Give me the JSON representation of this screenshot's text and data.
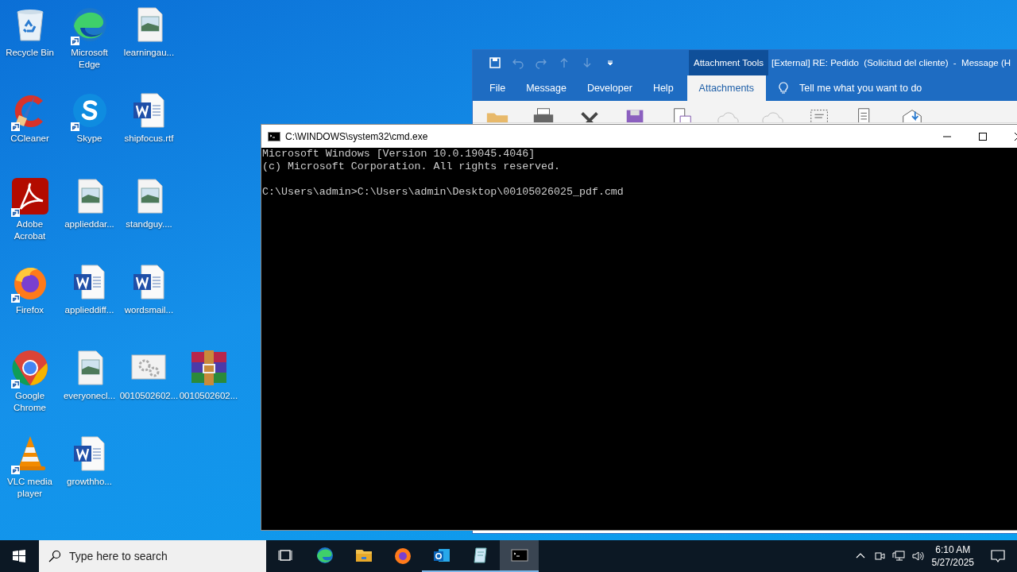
{
  "desktop": {
    "rows": [
      [
        {
          "label": "Recycle Bin",
          "kind": "recycle",
          "shortcut": false
        },
        {
          "label": "Microsoft Edge",
          "kind": "edge",
          "shortcut": true
        },
        {
          "label": "learningau...",
          "kind": "image",
          "shortcut": false
        }
      ],
      [
        {
          "label": "CCleaner",
          "kind": "ccleaner",
          "shortcut": true
        },
        {
          "label": "Skype",
          "kind": "skype",
          "shortcut": true
        },
        {
          "label": "shipfocus.rtf",
          "kind": "word",
          "shortcut": false
        }
      ],
      [
        {
          "label": "Adobe Acrobat",
          "kind": "acrobat",
          "shortcut": true
        },
        {
          "label": "applieddar...",
          "kind": "image",
          "shortcut": false
        },
        {
          "label": "standguy....",
          "kind": "image",
          "shortcut": false
        }
      ],
      [
        {
          "label": "Firefox",
          "kind": "firefox",
          "shortcut": true
        },
        {
          "label": "applieddiff...",
          "kind": "word",
          "shortcut": false
        },
        {
          "label": "wordsmail...",
          "kind": "word",
          "shortcut": false
        }
      ],
      [
        {
          "label": "Google Chrome",
          "kind": "chrome",
          "shortcut": true
        },
        {
          "label": "everyonecl...",
          "kind": "image",
          "shortcut": false
        },
        {
          "label": "0010502602...",
          "kind": "settings",
          "shortcut": false
        },
        {
          "label": "0010502602...",
          "kind": "rar",
          "shortcut": false
        }
      ],
      [
        {
          "label": "VLC media player",
          "kind": "vlc",
          "shortcut": true
        },
        {
          "label": "growthho...",
          "kind": "word",
          "shortcut": false
        }
      ]
    ]
  },
  "outlook": {
    "quick_access": [
      {
        "kind": "save",
        "disabled": false
      },
      {
        "kind": "undo",
        "disabled": true
      },
      {
        "kind": "redo",
        "disabled": true
      },
      {
        "kind": "up",
        "disabled": true
      },
      {
        "kind": "down",
        "disabled": true
      },
      {
        "kind": "customize",
        "disabled": false
      }
    ],
    "context_label": "Attachment Tools",
    "title": "[External] RE: Pedido  (Solicitud del cliente)  -  Message (H",
    "tabs": [
      {
        "label": "File",
        "selected": false
      },
      {
        "label": "Message",
        "selected": false
      },
      {
        "label": "Developer",
        "selected": false
      },
      {
        "label": "Help",
        "selected": false
      },
      {
        "label": "Attachments",
        "selected": true
      }
    ],
    "tell_me": "Tell me what you want to do"
  },
  "console": {
    "title": "C:\\WINDOWS\\system32\\cmd.exe",
    "blocks": [
      [
        "Microsoft Windows [Version 10.0.19045.4046]",
        "(c) Microsoft Corporation. All rights reserved."
      ],
      [
        "C:\\Users\\admin>C:\\Users\\admin\\Desktop\\00105026025_pdf.cmd"
      ]
    ]
  },
  "taskbar": {
    "search": {
      "placeholder": "Type here to search"
    },
    "apps": [
      {
        "kind": "taskview",
        "running": false,
        "active": false
      },
      {
        "kind": "edge",
        "running": false,
        "active": false
      },
      {
        "kind": "folder",
        "running": false,
        "active": false
      },
      {
        "kind": "firefox",
        "running": false,
        "active": false
      },
      {
        "kind": "outlook",
        "running": true,
        "active": false
      },
      {
        "kind": "notepad",
        "running": true,
        "active": false
      },
      {
        "kind": "cmd",
        "running": true,
        "active": true
      }
    ],
    "time": "6:10 AM",
    "date": "5/27/2025"
  }
}
